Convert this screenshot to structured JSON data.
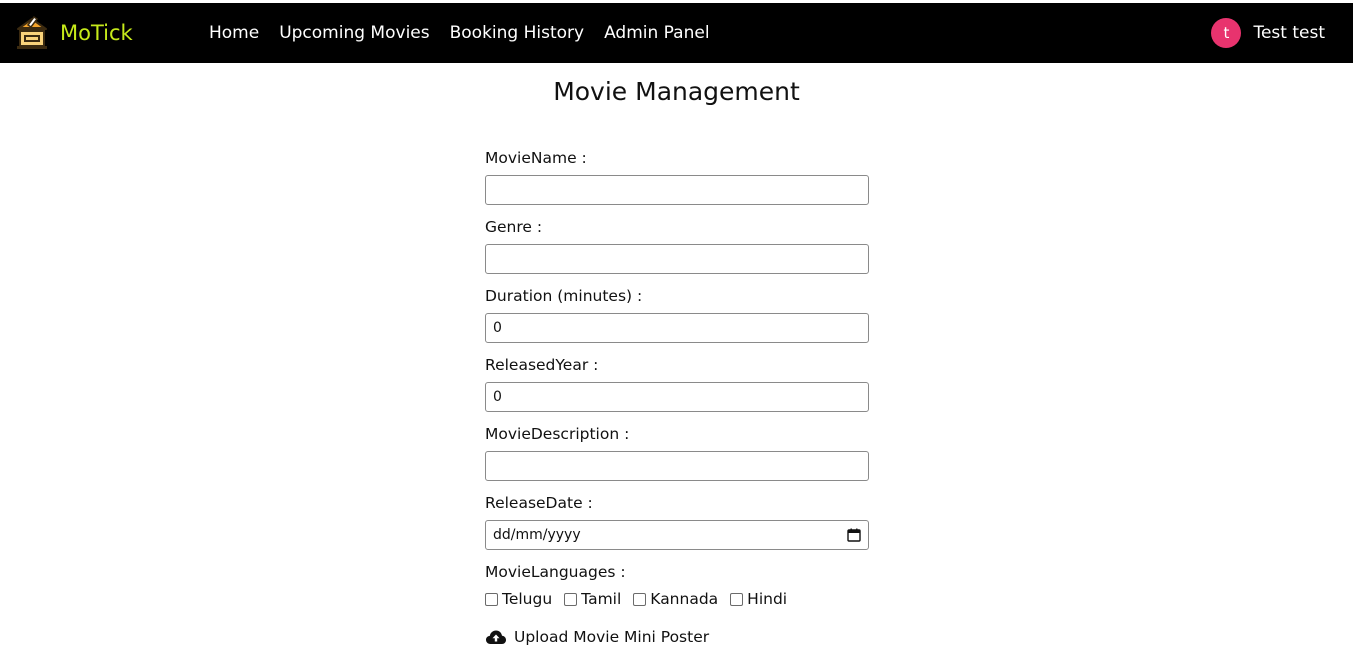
{
  "brand": {
    "name": "MoTick",
    "logo_icon": "ticket-logo-icon",
    "accent_color": "#c6ea1a"
  },
  "nav": {
    "links": [
      "Home",
      "Upcoming Movies",
      "Booking History",
      "Admin Panel"
    ]
  },
  "user": {
    "avatar_initial": "t",
    "name": "Test test",
    "avatar_color": "#e8336e"
  },
  "page": {
    "title": "Movie Management"
  },
  "form": {
    "movie_name": {
      "label": "MovieName :",
      "value": ""
    },
    "genre": {
      "label": "Genre :",
      "value": ""
    },
    "duration": {
      "label": "Duration (minutes) :",
      "value": "0"
    },
    "released_year": {
      "label": "ReleasedYear :",
      "value": "0"
    },
    "description": {
      "label": "MovieDescription :",
      "value": ""
    },
    "release_date": {
      "label": "ReleaseDate :",
      "placeholder": "dd/mm/yyyy",
      "icon": "calendar-icon"
    },
    "languages": {
      "label": "MovieLanguages :",
      "options": [
        {
          "label": "Telugu",
          "checked": false
        },
        {
          "label": "Tamil",
          "checked": false
        },
        {
          "label": "Kannada",
          "checked": false
        },
        {
          "label": "Hindi",
          "checked": false
        }
      ]
    },
    "upload": {
      "label": "Upload Movie Mini Poster",
      "icon": "cloud-upload-icon"
    }
  }
}
